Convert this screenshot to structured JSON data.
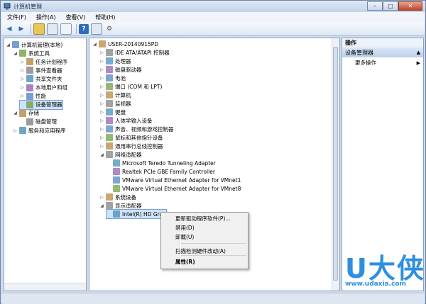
{
  "window": {
    "title": "计算机管理",
    "controls": {
      "minimize": "–",
      "maximize": "□",
      "close": "✕"
    }
  },
  "menu": [
    "文件(F)",
    "操作(A)",
    "查看(V)",
    "帮助(H)"
  ],
  "left_tree": [
    {
      "label": "计算机管理(本地)",
      "depth": 0,
      "exp": "◢"
    },
    {
      "label": "系统工具",
      "depth": 1,
      "exp": "◢"
    },
    {
      "label": "任务计划程序",
      "depth": 2,
      "exp": "▷"
    },
    {
      "label": "事件查看器",
      "depth": 2,
      "exp": "▷"
    },
    {
      "label": "共享文件夹",
      "depth": 2,
      "exp": "▷"
    },
    {
      "label": "本地用户和组",
      "depth": 2,
      "exp": "▷"
    },
    {
      "label": "性能",
      "depth": 2,
      "exp": "▷"
    },
    {
      "label": "设备管理器",
      "depth": 2,
      "exp": "",
      "selected": true
    },
    {
      "label": "存储",
      "depth": 1,
      "exp": "◢"
    },
    {
      "label": "磁盘管理",
      "depth": 2,
      "exp": ""
    },
    {
      "label": "服务和应用程序",
      "depth": 1,
      "exp": "▷"
    }
  ],
  "device_tree": [
    {
      "label": "USER-20140915PD",
      "depth": 0,
      "exp": "◢"
    },
    {
      "label": "IDE ATA/ATAPI 控制器",
      "depth": 1,
      "exp": "▷"
    },
    {
      "label": "处理器",
      "depth": 1,
      "exp": "▷"
    },
    {
      "label": "磁盘驱动器",
      "depth": 1,
      "exp": "▷"
    },
    {
      "label": "电池",
      "depth": 1,
      "exp": "▷"
    },
    {
      "label": "端口 (COM 和 LPT)",
      "depth": 1,
      "exp": "▷"
    },
    {
      "label": "计算机",
      "depth": 1,
      "exp": "▷"
    },
    {
      "label": "监视器",
      "depth": 1,
      "exp": "▷"
    },
    {
      "label": "键盘",
      "depth": 1,
      "exp": "▷"
    },
    {
      "label": "人体学输入设备",
      "depth": 1,
      "exp": "▷"
    },
    {
      "label": "声音、视频和游戏控制器",
      "depth": 1,
      "exp": "▷"
    },
    {
      "label": "鼠标和其他指针设备",
      "depth": 1,
      "exp": "▷"
    },
    {
      "label": "通用串行总线控制器",
      "depth": 1,
      "exp": "▷"
    },
    {
      "label": "网络适配器",
      "depth": 1,
      "exp": "◢"
    },
    {
      "label": "Microsoft Teredo Tunneling Adapter",
      "depth": 2,
      "exp": ""
    },
    {
      "label": "Realtek PCIe GBE Family Controller",
      "depth": 2,
      "exp": ""
    },
    {
      "label": "VMware Virtual Ethernet Adapter for VMnet1",
      "depth": 2,
      "exp": ""
    },
    {
      "label": "VMware Virtual Ethernet Adapter for VMnet8",
      "depth": 2,
      "exp": ""
    },
    {
      "label": "系统设备",
      "depth": 1,
      "exp": "▷"
    },
    {
      "label": "显示适配器",
      "depth": 1,
      "exp": "◢"
    },
    {
      "label": "Intel(R) HD Grap",
      "depth": 2,
      "exp": "",
      "selected": true
    }
  ],
  "actions": {
    "header": "操作",
    "section": "设备管理器",
    "more": "更多操作"
  },
  "context_menu": [
    {
      "label": "更新驱动程序软件(P)..."
    },
    {
      "label": "禁用(D)"
    },
    {
      "label": "卸载(U)"
    },
    {
      "label": "扫描检测硬件改动(A)"
    },
    {
      "label": "属性(R)",
      "bold": true
    }
  ],
  "watermark": {
    "big": "U大侠",
    "url": "www.udaxia.com"
  }
}
